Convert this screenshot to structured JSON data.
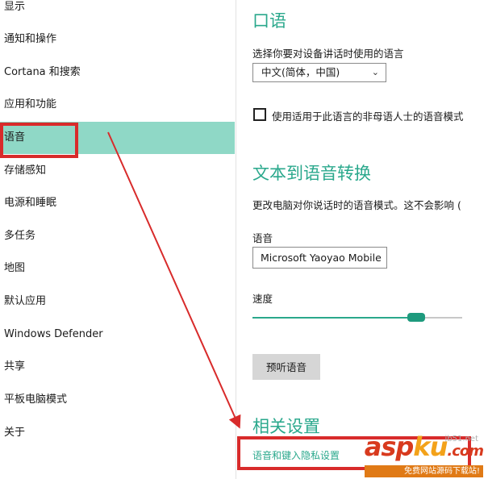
{
  "sidebar": {
    "items": [
      {
        "label": "显示"
      },
      {
        "label": "通知和操作"
      },
      {
        "label": "Cortana 和搜索"
      },
      {
        "label": "应用和功能"
      },
      {
        "label": "语音"
      },
      {
        "label": "存储感知"
      },
      {
        "label": "电源和睡眠"
      },
      {
        "label": "多任务"
      },
      {
        "label": "地图"
      },
      {
        "label": "默认应用"
      },
      {
        "label": "Windows Defender"
      },
      {
        "label": "共享"
      },
      {
        "label": "平板电脑模式"
      },
      {
        "label": "关于"
      }
    ],
    "selected_index": 4
  },
  "speech": {
    "title": "口语",
    "language_prompt": "选择你要对设备讲话时使用的语言",
    "language_value": "中文(简体，中国)",
    "nonnative_checkbox_label": "使用适用于此语言的非母语人士的语音模式",
    "nonnative_checked": false
  },
  "tts": {
    "title": "文本到语音转换",
    "description": "更改电脑对你说话时的语音模式。这不会影响 (",
    "voice_label": "语音",
    "voice_value": "Microsoft Yaoyao Mobile",
    "speed_label": "速度",
    "speed_fraction": 0.78,
    "preview_button": "预听语音"
  },
  "related": {
    "title": "相关设置",
    "link": "语音和键入隐私设置"
  },
  "colors": {
    "accent": "#2aa88c",
    "selection": "#8fd8c6",
    "annotation": "#d82b2b"
  },
  "watermark": {
    "brand_a": "asp",
    "brand_b": "ku",
    "brand_c": ".com",
    "tagline": "免费网站源码下载站!",
    "url": "jb51.net"
  }
}
